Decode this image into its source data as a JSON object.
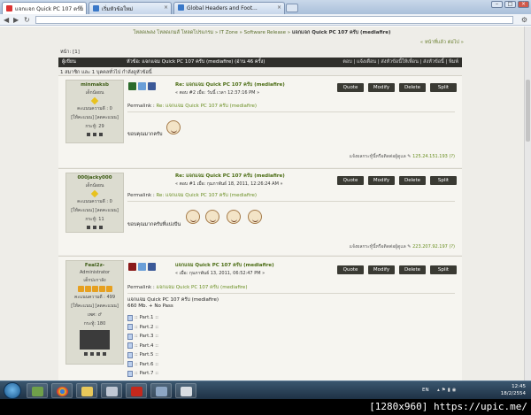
{
  "browser": {
    "tabs": [
      {
        "label": "แจกเเจก Quick PC 107 ตร์ม",
        "color": "#d33"
      },
      {
        "label": "เริ่มหัวข้อใหม่",
        "color": "#3a78c8"
      },
      {
        "label": "Global Headers and Foot...",
        "color": "#3a78c8"
      }
    ],
    "address": "",
    "window_buttons": [
      "–",
      "□",
      "×"
    ]
  },
  "page": {
    "breadcrumb_prefix": "โหลดเพลง โหลดเกมส์ โหลดโปรแกรม » IT Zone » Software Release » ",
    "breadcrumb_current": "แจกเเจก Quick PC 107 ครับ (mediafire)",
    "nav_links": "« หน้าที่แล้ว ต่อไป »",
    "page_label": "หน้า: [1]",
    "thread_bar_left": "ผู้เขียน",
    "thread_bar_title": "หัวข้อ: แจกแจม Quick PC 107 ครับ (mediafire)  (อ่าน 46 ครั้ง)",
    "thread_tools": "ตอบ | แจ้งเตือน | ส่งหัวข้อนี้ให้เพื่อน | ส่งหัวข้อนี้ | พิมพ์",
    "viewers": "1 สมาชิก และ 1 บุคคลทั่วไป กำลังดูหัวข้อนี้"
  },
  "buttons": {
    "quote": "Quote",
    "modify": "Modify",
    "delete": "Delete",
    "split": "Split"
  },
  "posts": [
    {
      "username": "minmaksb",
      "rank": "เด็กน้อยน",
      "points": "คะแนนความดี : 0",
      "status": "[ให้คะแนน] [ลดคะแนน]",
      "count": "กระทู้: 29",
      "title": "Re: แจกแจม Quick PC 107 ครับ (mediafire)",
      "meta": "« ตอบ #2 เมื่อ: วันนี้ เวลา 12:37:16 PM »",
      "permalink_label": "Permalink : ",
      "permalink": "Re: แจกแจม Quick PC 107 ครับ (mediafire)",
      "message": "ขอบคุณมากครับ",
      "report": "แจ้งผลกระทู้นี้หรือติดต่อผู้ดูแล",
      "ip": "125.24.151.193 (?)"
    },
    {
      "username": "000jacky000",
      "rank": "เด็กน้อยน",
      "points": "คะแนนความดี : 0",
      "status": "[ให้คะแนน] [ลดคะแนน]",
      "count": "กระทู้: 11",
      "title": "Re: แจกแจม Quick PC 107 ครับ (mediafire)",
      "meta": "« ตอบ #1 เมื่อ: กุมภาพันธ์ 18, 2011, 12:26:24 AM »",
      "permalink_label": "Permalink : ",
      "permalink": "Re: แจกแจม Quick PC 107 ครับ (mediafire)",
      "message": "ขอบคุณมากครับที่แบ่งปัน",
      "report": "แจ้งผลกระทู้นี้หรือติดต่อผู้ดูแล",
      "ip": "223.207.92.197 (?)"
    },
    {
      "username": "Feal2z-",
      "rank": "Administrator",
      "subrank": "เด็กปะกาลัง",
      "points": "คะแนนความดี : 499",
      "status": "[ให้คะแนน] [ลดคะแนน]",
      "gender": "เพศ: ♂",
      "count": "กระทู้: 180",
      "title": "แจกแจม Quick PC 107 ครับ (mediafire)",
      "meta": "« เมื่อ: กุมภาพันธ์ 13, 2011, 06:52:47 PM »",
      "permalink_label": "Permalink : ",
      "permalink": "แจกแจม Quick PC 107 ครับ (mediafire)",
      "message_line1": "แจกแจม Quick PC 107 ครับ (mediafire)",
      "message_line2": "660 Mb. + No Pass",
      "parts": [
        ":: Part.1 ::",
        ":: Part.2 ::",
        ":: Part.3 ::",
        ":: Part.4 ::",
        ":: Part.5 ::",
        ":: Part.6 ::",
        ":: Part.7 ::"
      ]
    }
  ],
  "taskbar": {
    "lang": "EN",
    "time": "12:45",
    "date": "18/2/2554"
  },
  "watermark": "[1280x960] https://upic.me/"
}
